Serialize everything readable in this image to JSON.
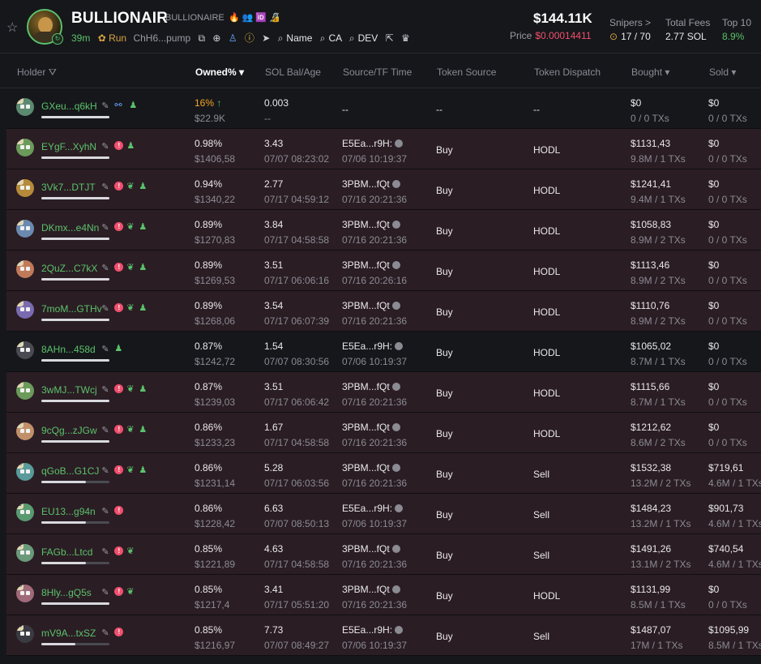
{
  "header": {
    "token_name": "BULLIONAIR",
    "token_sub": "BULLIONAIRE",
    "header_icons": "🔥👥🆔🔏",
    "age": "39m",
    "run_label": "Run",
    "address": "ChH6...pump",
    "name_label": "Name",
    "ca_label": "CA",
    "dev_label": "DEV",
    "market_cap": "$144.11K",
    "price_label": "Price",
    "price_value": "$0.00014411",
    "snipers_label": "Snipers >",
    "snipers_value": "17 / 70",
    "fees_label": "Total Fees",
    "fees_value": "2.77 SOL",
    "top10_label": "Top 10",
    "top10_value": "8.9%"
  },
  "columns": {
    "holder": "Holder",
    "owned": "Owned% ▾",
    "sol": "SOL Bal/Age",
    "source_time": "Source/TF Time",
    "token_source": "Token Source",
    "token_dispatch": "Token Dispatch",
    "bought": "Bought ▾",
    "sold": "Sold ▾"
  },
  "rows": [
    {
      "name": "GXeu...q6kH",
      "owned": "16%",
      "owned_usd": "$22.9K",
      "sol": "0.003",
      "sol_age": "--",
      "src": "--",
      "src_time": "",
      "token_src": "--",
      "dispatch": "--",
      "bought": "$0",
      "bought_sub": "0 / 0 TXs",
      "sold": "$0",
      "sold_sub": "0 / 0 TXs",
      "rank": "1",
      "type": "top",
      "bar": 1.0
    },
    {
      "name": "EYgF...XyhN",
      "owned": "0.98%",
      "owned_usd": "$1406,58",
      "sol": "3.43",
      "sol_age": "07/07 08:23:02",
      "src": "E5Ea...r9H:",
      "src_time": "07/06 10:19:37",
      "token_src": "Buy",
      "dispatch": "HODL",
      "bought": "$1131,43",
      "bought_sub": "9.8M / 1 TXs",
      "sold": "$0",
      "sold_sub": "0 / 0 TXs",
      "rank": "2",
      "type": "sniper",
      "bar": 1.0
    },
    {
      "name": "3Vk7...DTJT",
      "owned": "0.94%",
      "owned_usd": "$1340,22",
      "sol": "2.77",
      "sol_age": "07/17 04:59:12",
      "src": "3PBM...fQt",
      "src_time": "07/16 20:21:36",
      "token_src": "Buy",
      "dispatch": "HODL",
      "bought": "$1241,41",
      "bought_sub": "9.4M / 1 TXs",
      "sold": "$0",
      "sold_sub": "0 / 0 TXs",
      "rank": "3",
      "type": "sniper",
      "bar": 1.0
    },
    {
      "name": "DKmx...e4Nn",
      "owned": "0.89%",
      "owned_usd": "$1270,83",
      "sol": "3.84",
      "sol_age": "07/17 04:58:58",
      "src": "3PBM...fQt",
      "src_time": "07/16 20:21:36",
      "token_src": "Buy",
      "dispatch": "HODL",
      "bought": "$1058,83",
      "bought_sub": "8.9M / 2 TXs",
      "sold": "$0",
      "sold_sub": "0 / 0 TXs",
      "rank": "4",
      "type": "sniper",
      "bar": 1.0
    },
    {
      "name": "2QuZ...C7kX",
      "owned": "0.89%",
      "owned_usd": "$1269,53",
      "sol": "3.51",
      "sol_age": "07/17 06:06:16",
      "src": "3PBM...fQt",
      "src_time": "07/16 20:26:16",
      "token_src": "Buy",
      "dispatch": "HODL",
      "bought": "$1113,46",
      "bought_sub": "8.9M / 2 TXs",
      "sold": "$0",
      "sold_sub": "0 / 0 TXs",
      "rank": "5",
      "type": "sniper",
      "bar": 1.0
    },
    {
      "name": "7moM...GTHv",
      "owned": "0.89%",
      "owned_usd": "$1268,06",
      "sol": "3.54",
      "sol_age": "07/17 06:07:39",
      "src": "3PBM...fQt",
      "src_time": "07/16 20:21:36",
      "token_src": "Buy",
      "dispatch": "HODL",
      "bought": "$1110,76",
      "bought_sub": "8.9M / 2 TXs",
      "sold": "$0",
      "sold_sub": "0 / 0 TXs",
      "rank": "6",
      "type": "sniper",
      "bar": 1.0
    },
    {
      "name": "8AHn...458d",
      "owned": "0.87%",
      "owned_usd": "$1242,72",
      "sol": "1.54",
      "sol_age": "07/07 08:30:56",
      "src": "E5Ea...r9H:",
      "src_time": "07/06 10:19:37",
      "token_src": "Buy",
      "dispatch": "HODL",
      "bought": "$1065,02",
      "bought_sub": "8.7M / 1 TXs",
      "sold": "$0",
      "sold_sub": "0 / 0 TXs",
      "rank": "7",
      "type": "normal",
      "bar": 1.0
    },
    {
      "name": "3wMJ...TWcj",
      "owned": "0.87%",
      "owned_usd": "$1239,03",
      "sol": "3.51",
      "sol_age": "07/17 06:06:42",
      "src": "3PBM...fQt",
      "src_time": "07/16 20:21:36",
      "token_src": "Buy",
      "dispatch": "HODL",
      "bought": "$1115,66",
      "bought_sub": "8.7M / 1 TXs",
      "sold": "$0",
      "sold_sub": "0 / 0 TXs",
      "rank": "8",
      "type": "sniper",
      "bar": 1.0
    },
    {
      "name": "9cQg...zJGw",
      "owned": "0.86%",
      "owned_usd": "$1233,23",
      "sol": "1.67",
      "sol_age": "07/17 04:58:58",
      "src": "3PBM...fQt",
      "src_time": "07/16 20:21:36",
      "token_src": "Buy",
      "dispatch": "HODL",
      "bought": "$1212,62",
      "bought_sub": "8.6M / 2 TXs",
      "sold": "$0",
      "sold_sub": "0 / 0 TXs",
      "rank": "9",
      "type": "sniper",
      "bar": 1.0
    },
    {
      "name": "qGoB...G1CJ",
      "owned": "0.86%",
      "owned_usd": "$1231,14",
      "sol": "5.28",
      "sol_age": "07/17 06:03:56",
      "src": "3PBM...fQt",
      "src_time": "07/16 20:21:36",
      "token_src": "Buy",
      "dispatch": "Sell",
      "bought": "$1532,38",
      "bought_sub": "13.2M / 2 TXs",
      "sold": "$719,61",
      "sold_sub": "4.6M / 1 TXs",
      "rank": "10",
      "type": "sniper",
      "bar": 0.65
    },
    {
      "name": "EU13...g94n",
      "owned": "0.86%",
      "owned_usd": "$1228,42",
      "sol": "6.63",
      "sol_age": "07/07 08:50:13",
      "src": "E5Ea...r9H:",
      "src_time": "07/06 10:19:37",
      "token_src": "Buy",
      "dispatch": "Sell",
      "bought": "$1484,23",
      "bought_sub": "13.2M / 1 TXs",
      "sold": "$901,73",
      "sold_sub": "4.6M / 1 TXs",
      "rank": "11",
      "type": "sniper",
      "bar": 0.65
    },
    {
      "name": "FAGb...Ltcd",
      "owned": "0.85%",
      "owned_usd": "$1221,89",
      "sol": "4.63",
      "sol_age": "07/17 04:58:58",
      "src": "3PBM...fQt",
      "src_time": "07/16 20:21:36",
      "token_src": "Buy",
      "dispatch": "Sell",
      "bought": "$1491,26",
      "bought_sub": "13.1M / 2 TXs",
      "sold": "$740,54",
      "sold_sub": "4.6M / 1 TXs",
      "rank": "12",
      "type": "sniper",
      "bar": 0.65
    },
    {
      "name": "8Hly...gQ5s",
      "owned": "0.85%",
      "owned_usd": "$1217,4",
      "sol": "3.41",
      "sol_age": "07/17 05:51:20",
      "src": "3PBM...fQt",
      "src_time": "07/16 20:21:36",
      "token_src": "Buy",
      "dispatch": "HODL",
      "bought": "$1131,99",
      "bought_sub": "8.5M / 1 TXs",
      "sold": "$0",
      "sold_sub": "0 / 0 TXs",
      "rank": "13",
      "type": "sniper",
      "bar": 1.0
    },
    {
      "name": "mV9A...txSZ",
      "owned": "0.85%",
      "owned_usd": "$1216,97",
      "sol": "7.73",
      "sol_age": "07/07 08:49:27",
      "src": "E5Ea...r9H:",
      "src_time": "07/06 10:19:37",
      "token_src": "Buy",
      "dispatch": "Sell",
      "bought": "$1487,07",
      "bought_sub": "17M / 1 TXs",
      "sold": "$1095,99",
      "sold_sub": "8.5M / 1 TXs",
      "rank": "14",
      "type": "sniper",
      "bar": 0.5
    }
  ]
}
